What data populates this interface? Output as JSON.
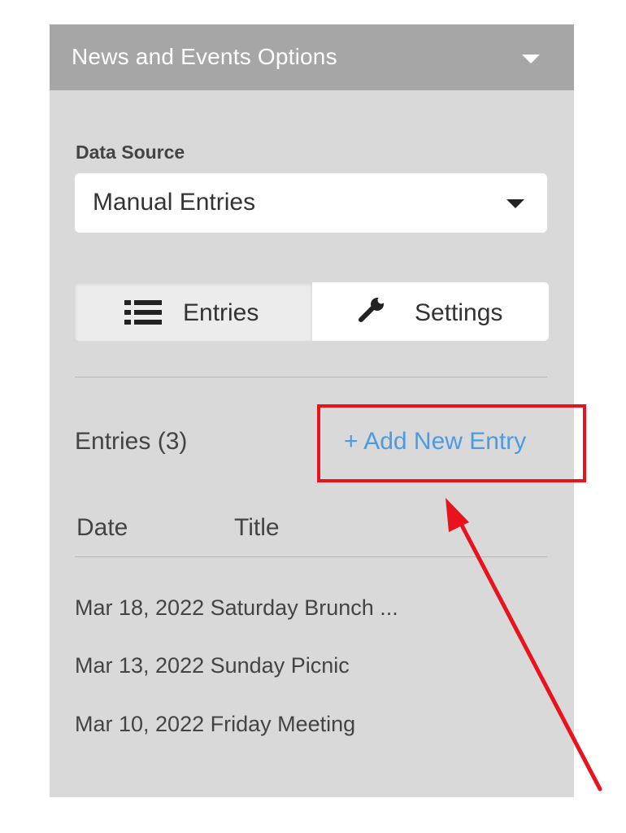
{
  "panel": {
    "title": "News and Events Options"
  },
  "data_source": {
    "label": "Data Source",
    "value": "Manual Entries"
  },
  "tabs": [
    {
      "label": "Entries",
      "icon": "list-icon",
      "active": true
    },
    {
      "label": "Settings",
      "icon": "wrench-icon",
      "active": false
    }
  ],
  "entries": {
    "count_label": "Entries (3)",
    "add_label": "+ Add New Entry",
    "columns": [
      "Date",
      "Title"
    ],
    "rows": [
      {
        "date": "Mar 18, 2022",
        "title": "Saturday Brunch ..."
      },
      {
        "date": "Mar 13, 2022",
        "title": "Sunday Picnic"
      },
      {
        "date": "Mar 10, 2022",
        "title": "Friday Meeting"
      }
    ]
  },
  "colors": {
    "header_bg": "#a6a6a6",
    "panel_bg": "#d9d9d9",
    "link": "#4a9be6",
    "annotation": "#e8131c"
  }
}
